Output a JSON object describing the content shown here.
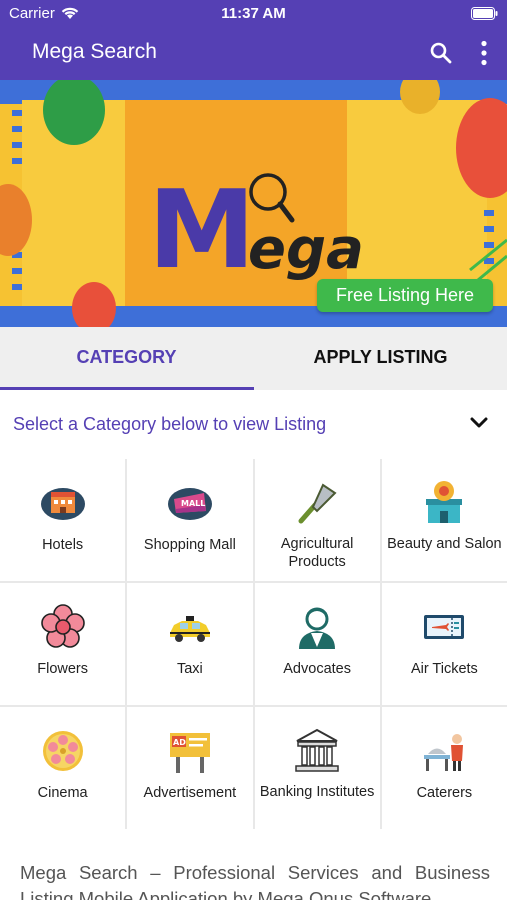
{
  "status_bar": {
    "carrier": "Carrier",
    "time": "11:37 AM"
  },
  "app_bar": {
    "title": "Mega Search"
  },
  "banner": {
    "logo_text": "Mega",
    "cta": "Free Listing Here"
  },
  "tabs": [
    {
      "label": "CATEGORY",
      "active": true
    },
    {
      "label": "APPLY LISTING",
      "active": false
    }
  ],
  "category_select": {
    "label": "Select a Category below to view Listing"
  },
  "categories": [
    {
      "label": "Hotels",
      "icon": "hotel-icon"
    },
    {
      "label": "Shopping Mall",
      "icon": "shopping-mall-icon"
    },
    {
      "label": "Agricultural Products",
      "icon": "trowel-icon"
    },
    {
      "label": "Beauty and Salon",
      "icon": "salon-icon"
    },
    {
      "label": "Flowers",
      "icon": "flower-icon"
    },
    {
      "label": "Taxi",
      "icon": "taxi-icon"
    },
    {
      "label": "Advocates",
      "icon": "advocate-icon"
    },
    {
      "label": "Air Tickets",
      "icon": "air-ticket-icon"
    },
    {
      "label": "Cinema",
      "icon": "film-reel-icon"
    },
    {
      "label": "Advertisement",
      "icon": "billboard-icon"
    },
    {
      "label": "Banking Institutes",
      "icon": "bank-icon"
    },
    {
      "label": "Caterers",
      "icon": "caterer-icon"
    }
  ],
  "description": "Mega Search – Professional Services and Business Listing Mobile Application by Mega Onus Software",
  "colors": {
    "primary": "#5540b4",
    "cta": "#3fb94b",
    "banner_bg": "#f6c232"
  }
}
